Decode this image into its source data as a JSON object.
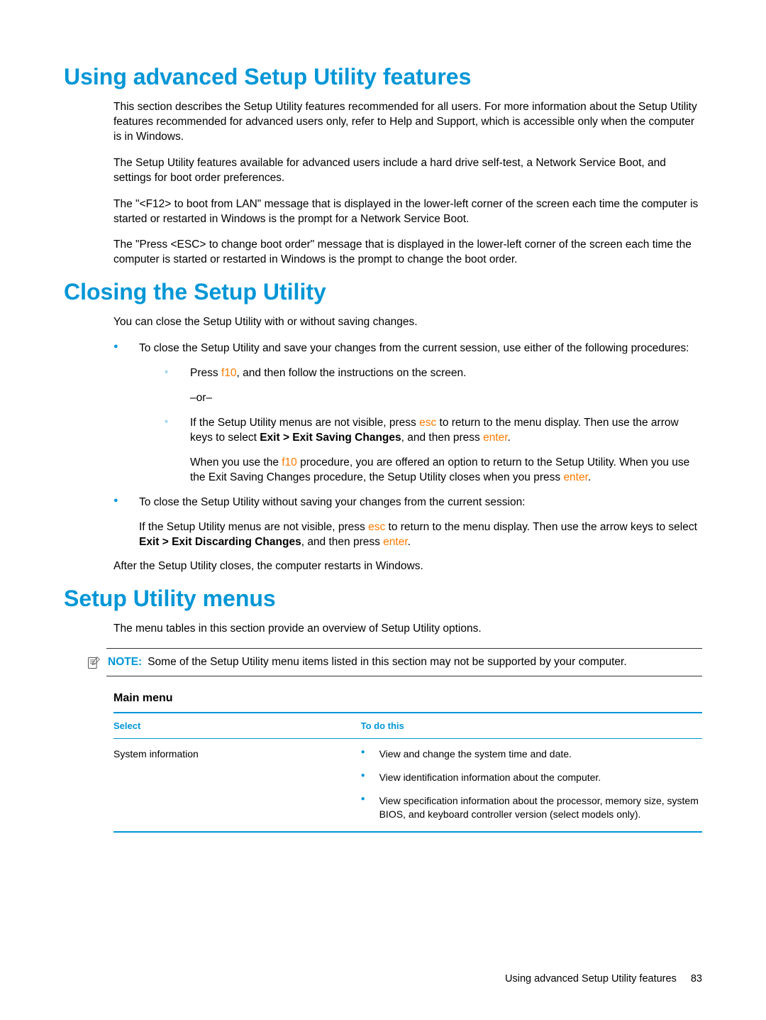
{
  "section1": {
    "heading": "Using advanced Setup Utility features",
    "p1": "This section describes the Setup Utility features recommended for all users. For more information about the Setup Utility features recommended for advanced users only, refer to Help and Support, which is accessible only when the computer is in Windows.",
    "p2": "The Setup Utility features available for advanced users include a hard drive self-test, a Network Service Boot, and settings for boot order preferences.",
    "p3": "The \"<F12> to boot from LAN\" message that is displayed in the lower-left corner of the screen each time the computer is started or restarted in Windows is the prompt for a Network Service Boot.",
    "p4": "The \"Press <ESC> to change boot order\" message that is displayed in the lower-left corner of the screen each time the computer is started or restarted in Windows is the prompt to change the boot order."
  },
  "section2": {
    "heading": "Closing the Setup Utility",
    "p1": "You can close the Setup Utility with or without saving changes.",
    "bullet1": "To close the Setup Utility and save your changes from the current session, use either of the following procedures:",
    "sub1a_pre": "Press ",
    "sub1a_key": "f10",
    "sub1a_post": ", and then follow the instructions on the screen.",
    "or": "–or–",
    "sub1b_pre": "If the Setup Utility menus are not visible, press ",
    "sub1b_key": "esc",
    "sub1b_mid": " to return to the menu display. Then use the arrow keys to select ",
    "sub1b_bold": "Exit > Exit Saving Changes",
    "sub1b_mid2": ", and then press ",
    "sub1b_key2": "enter",
    "sub1b_post": ".",
    "sub1b_note_pre": "When you use the ",
    "sub1b_note_key": "f10",
    "sub1b_note_mid": " procedure, you are offered an option to return to the Setup Utility. When you use the Exit Saving Changes procedure, the Setup Utility closes when you press ",
    "sub1b_note_key2": "enter",
    "sub1b_note_post": ".",
    "bullet2": "To close the Setup Utility without saving your changes from the current session:",
    "bullet2_p_pre": "If the Setup Utility menus are not visible, press ",
    "bullet2_p_key": "esc",
    "bullet2_p_mid": " to return to the menu display. Then use the arrow keys to select ",
    "bullet2_p_bold": "Exit > Exit Discarding Changes",
    "bullet2_p_mid2": ", and then press ",
    "bullet2_p_key2": "enter",
    "bullet2_p_post": ".",
    "p_last": "After the Setup Utility closes, the computer restarts in Windows."
  },
  "section3": {
    "heading": "Setup Utility menus",
    "p1": "The menu tables in this section provide an overview of Setup Utility options.",
    "note_label": "NOTE:",
    "note_text": "Some of the Setup Utility menu items listed in this section may not be supported by your computer.",
    "subhead": "Main menu",
    "col1": "Select",
    "col2": "To do this",
    "row_select": "System information",
    "row_b1": "View and change the system time and date.",
    "row_b2": "View identification information about the computer.",
    "row_b3": "View specification information about the processor, memory size, system BIOS, and keyboard controller version (select models only)."
  },
  "footer": {
    "text": "Using advanced Setup Utility features",
    "page": "83"
  }
}
